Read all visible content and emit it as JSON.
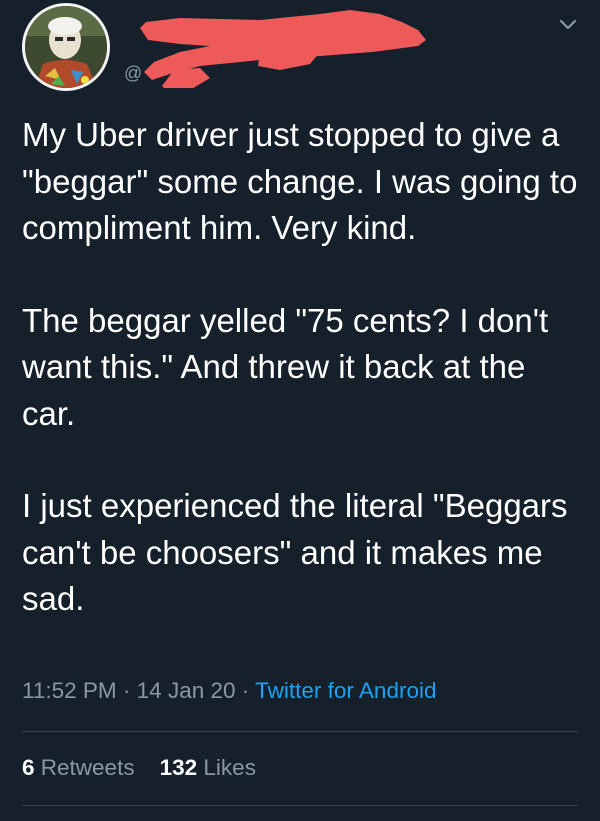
{
  "header": {
    "avatar_icon": "profile-photo",
    "handle_prefix": "@",
    "chevron_icon": "chevron-down-icon",
    "redaction_color": "#ee5a5a"
  },
  "tweet": {
    "paragraphs": [
      "My Uber driver just stopped to give a \"beggar\" some change. I was going to compliment him. Very kind.",
      "The beggar yelled \"75 cents? I don't want this.\" And threw it back at the car.",
      "I just experienced the literal \"Beggars can't be choosers\" and it makes me sad."
    ],
    "time": "11:52 PM",
    "date": "14 Jan 20",
    "separator": "·",
    "source": "Twitter for Android"
  },
  "stats": {
    "retweets_count": "6",
    "retweets_label": "Retweets",
    "likes_count": "132",
    "likes_label": "Likes"
  },
  "colors": {
    "background": "#15202b",
    "text": "#ffffff",
    "secondary": "#8899a6",
    "link": "#1da1f2",
    "divider": "#38444d"
  }
}
